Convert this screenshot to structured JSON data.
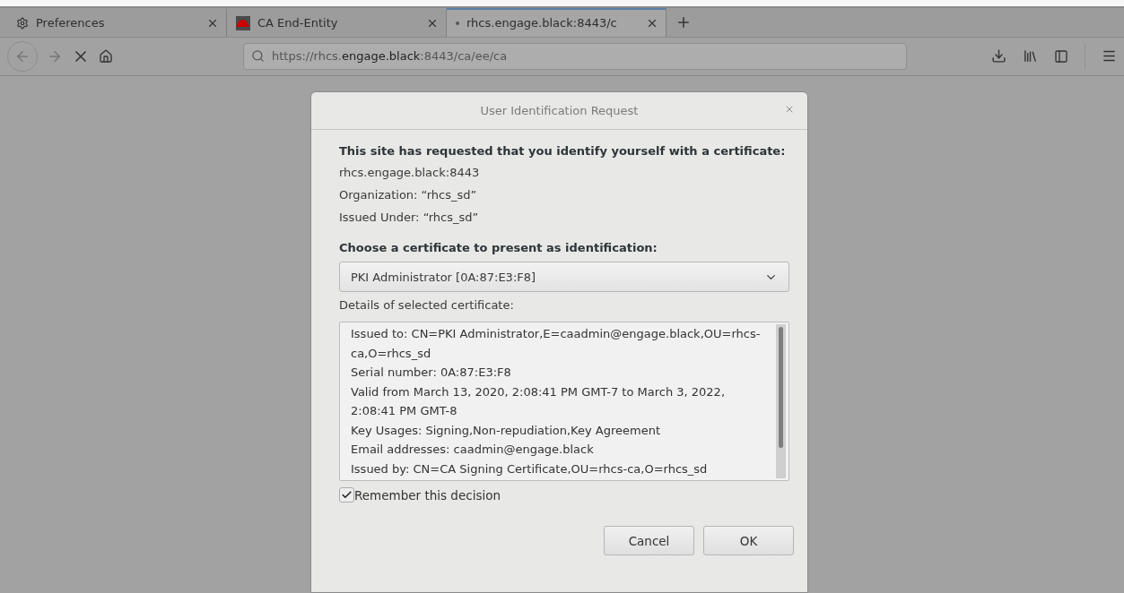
{
  "tabs": [
    {
      "kind": "settings",
      "label": "Preferences",
      "selected": false
    },
    {
      "kind": "favicon",
      "label": "CA End-Entity",
      "selected": false
    },
    {
      "kind": "loading",
      "label": "rhcs.engage.black:8443/c",
      "selected": true
    }
  ],
  "url": "https://rhcs.**engage.black**:8443/ca/ee/ca",
  "dialog": {
    "title": "User Identification Request",
    "heading": "This site has requested that you identify yourself with a certificate:",
    "site_lines": [
      "rhcs.engage.black:8443",
      "Organization: “rhcs_sd”",
      "Issued Under: “rhcs_sd”"
    ],
    "choose_label": "Choose a certificate to present as identification:",
    "certificate": "PKI Administrator [0A:87:E3:F8]",
    "details_label": "Details of selected certificate:",
    "details": [
      "Issued to: CN=PKI Administrator,E=caadmin@engage.black,OU=rhcs-ca,O=rhcs_sd",
      "Serial number: 0A:87:E3:F8",
      "Valid from March 13, 2020, 2:08:41 PM GMT-7 to March 3, 2022, 2:08:41 PM GMT-8",
      "Key Usages: Signing,Non-repudiation,Key Agreement",
      "Email addresses: caadmin@engage.black",
      "Issued by: CN=CA Signing Certificate,OU=rhcs-ca,O=rhcs_sd"
    ],
    "remember": {
      "label": "Remember this decision",
      "checked": true
    },
    "buttons": [
      "Cancel",
      "OK"
    ]
  }
}
